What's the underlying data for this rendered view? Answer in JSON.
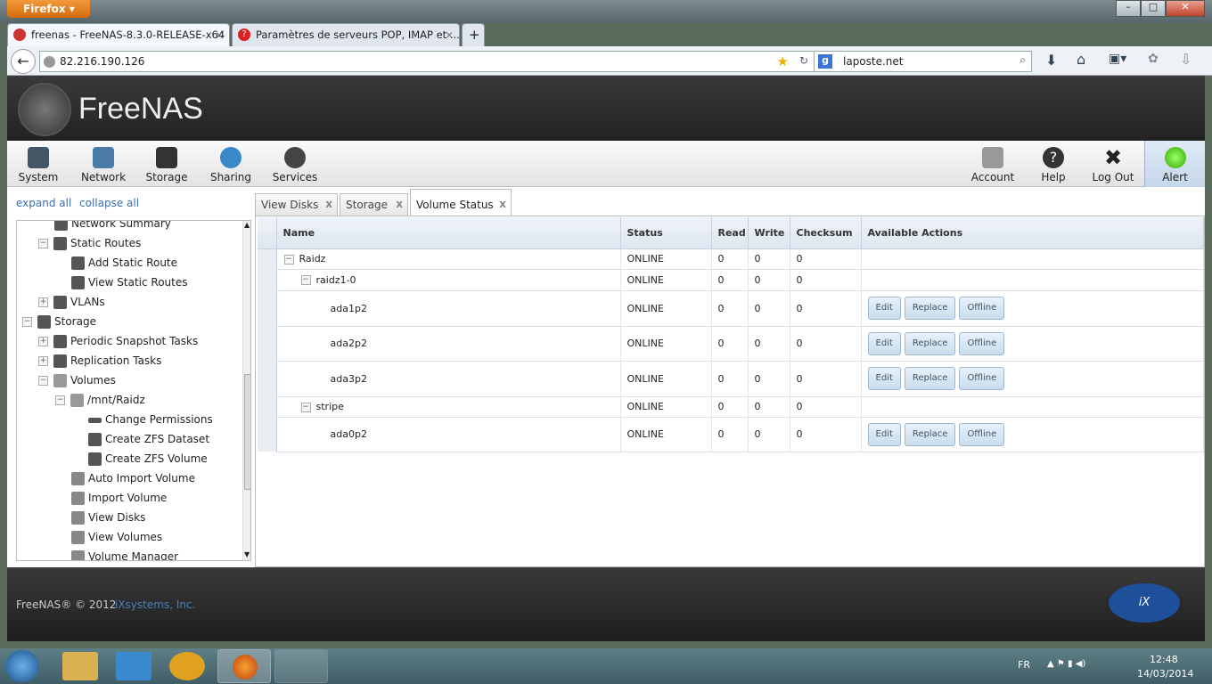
{
  "browser": {
    "menu": "Firefox",
    "tabs": [
      {
        "title": "freenas - FreeNAS-8.3.0-RELEASE-x64 ..."
      },
      {
        "title": "Paramètres de serveurs POP, IMAP et ..."
      }
    ],
    "new_tab": "+",
    "url": "82.216.190.126",
    "search": "laposte.net"
  },
  "app": {
    "logo": "FreeNAS",
    "toolbar": [
      "System",
      "Network",
      "Storage",
      "Sharing",
      "Services"
    ],
    "toolbar_right": [
      "Account",
      "Help",
      "Log Out",
      "Alert"
    ],
    "expand_all": "expand all",
    "collapse_all": "collapse all",
    "tree": [
      "Network Summary",
      "Static Routes",
      "Add Static Route",
      "View Static Routes",
      "VLANs",
      "Storage",
      "Periodic Snapshot Tasks",
      "Replication Tasks",
      "Volumes",
      "/mnt/Raidz",
      "Change Permissions",
      "Create ZFS Dataset",
      "Create ZFS Volume",
      "Auto Import Volume",
      "Import Volume",
      "View Disks",
      "View Volumes",
      "Volume Manager"
    ],
    "tabs": [
      "View Disks",
      "Storage",
      "Volume Status"
    ],
    "columns": [
      "Name",
      "Status",
      "Read",
      "Write",
      "Checksum",
      "Available Actions"
    ],
    "rows": [
      {
        "name": "Raidz",
        "status": "ONLINE",
        "read": "0",
        "write": "0",
        "checksum": "0"
      },
      {
        "name": "raidz1-0",
        "status": "ONLINE",
        "read": "0",
        "write": "0",
        "checksum": "0"
      },
      {
        "name": "ada1p2",
        "status": "ONLINE",
        "read": "0",
        "write": "0",
        "checksum": "0"
      },
      {
        "name": "ada2p2",
        "status": "ONLINE",
        "read": "0",
        "write": "0",
        "checksum": "0"
      },
      {
        "name": "ada3p2",
        "status": "ONLINE",
        "read": "0",
        "write": "0",
        "checksum": "0"
      },
      {
        "name": "stripe",
        "status": "ONLINE",
        "read": "0",
        "write": "0",
        "checksum": "0"
      },
      {
        "name": "ada0p2",
        "status": "ONLINE",
        "read": "0",
        "write": "0",
        "checksum": "0"
      }
    ],
    "actions": [
      "Edit",
      "Replace",
      "Offline"
    ],
    "footer": "FreeNAS® © 2012",
    "footer_link": "iXsystems, Inc.",
    "ix_logo": "iXsystems"
  },
  "taskbar": {
    "lang": "FR",
    "time": "12:48",
    "date": "14/03/2014"
  }
}
